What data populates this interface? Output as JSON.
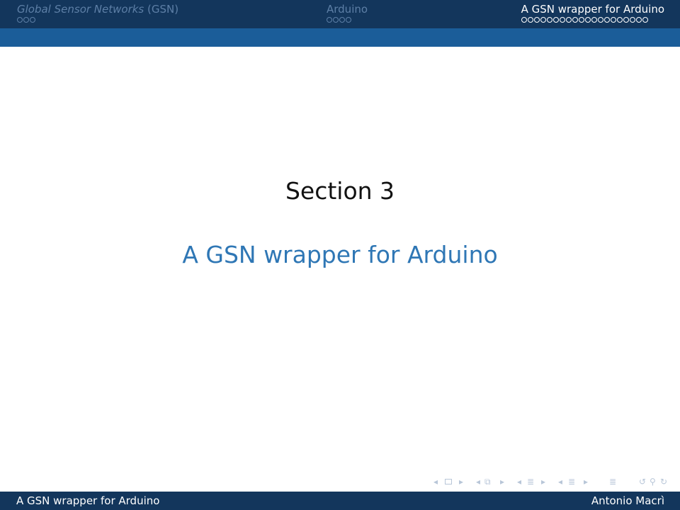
{
  "headline": {
    "sections": [
      {
        "title_part1": "Global Sensor Networks",
        "title_part2": " (GSN)",
        "dots": 3,
        "active": false
      },
      {
        "title": "Arduino",
        "dots": 4,
        "active": false
      },
      {
        "title": "A GSN wrapper for Arduino",
        "dots": 20,
        "active": true
      }
    ]
  },
  "slide": {
    "section_label": "Section 3",
    "section_title": "A GSN wrapper for Arduino"
  },
  "footer": {
    "title": "A GSN wrapper for Arduino",
    "author": "Antonio Macrì"
  },
  "colors": {
    "headline_bg": "#13365c",
    "subband_bg": "#1b5d99",
    "accent": "#2f77b5"
  }
}
